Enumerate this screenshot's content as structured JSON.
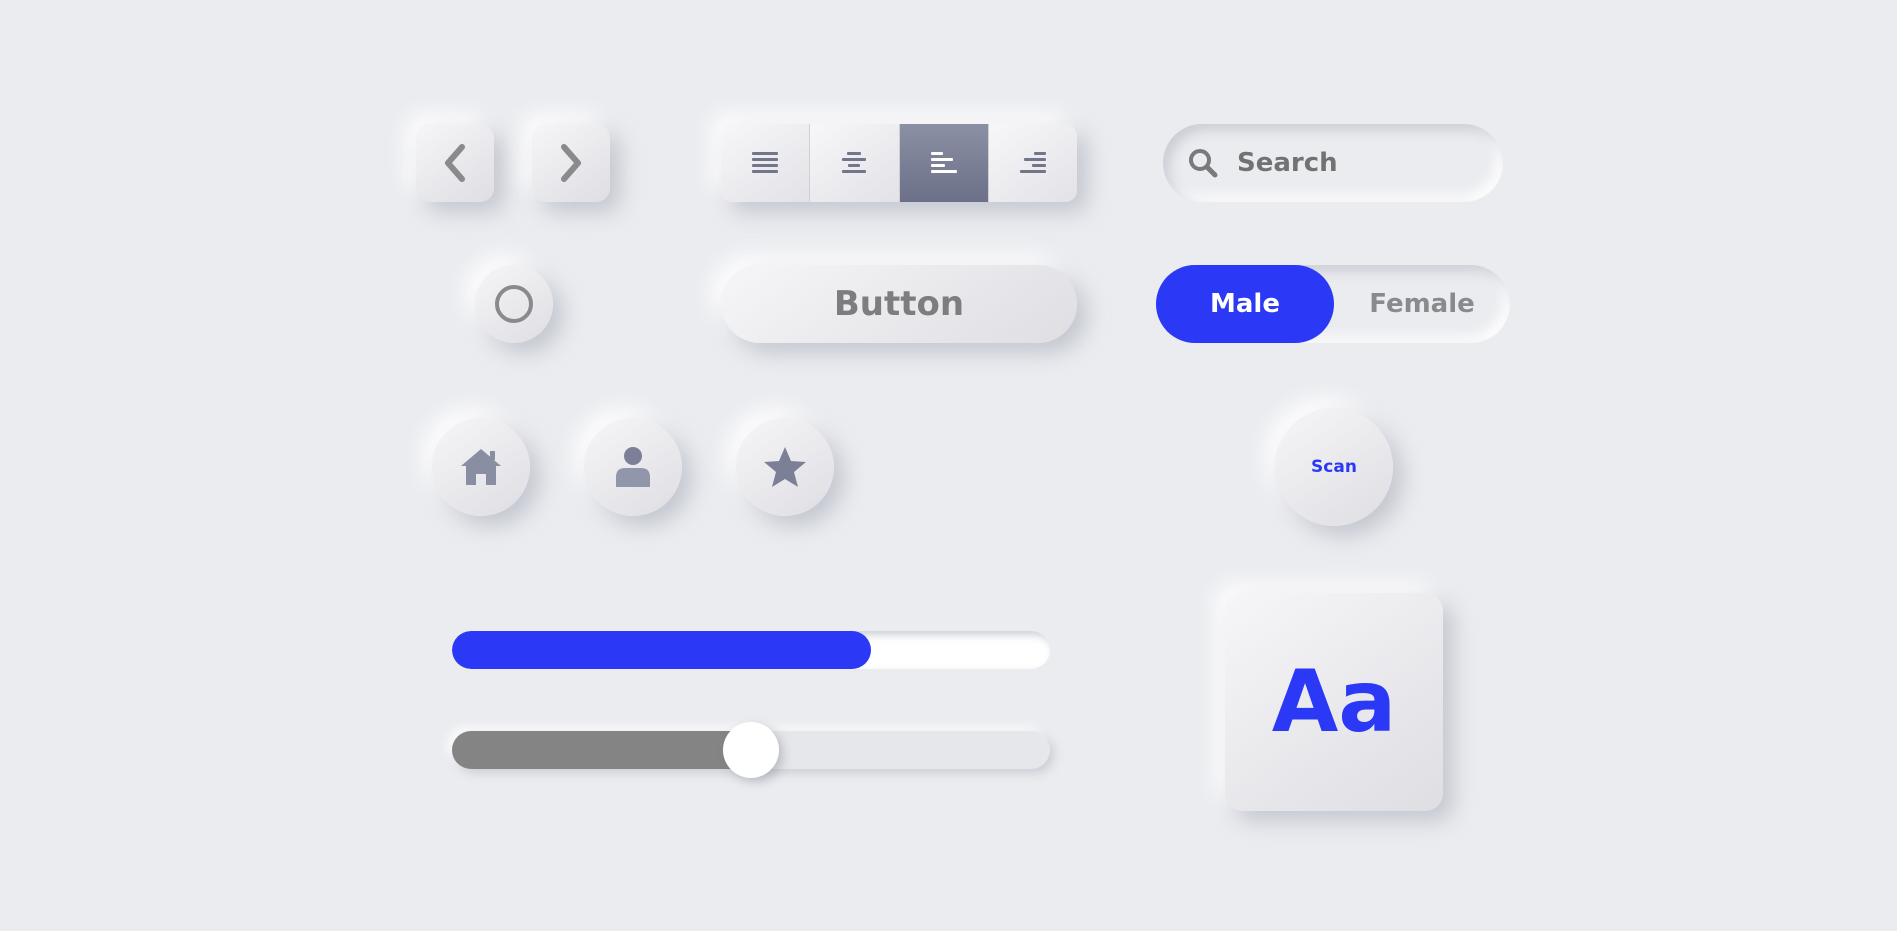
{
  "nav": {
    "prev_icon": "chevron-left-icon",
    "next_icon": "chevron-right-icon"
  },
  "align": {
    "options": [
      "align-justify-icon",
      "align-center-icon",
      "align-left-icon",
      "align-right-icon"
    ],
    "selected": "align-left"
  },
  "search": {
    "placeholder": "Search",
    "icon": "search-icon"
  },
  "radio": {
    "checked": false
  },
  "button": {
    "label": "Button"
  },
  "gender": {
    "male": "Male",
    "female": "Female",
    "selected": "Male"
  },
  "icon_buttons": [
    "home-icon",
    "user-icon",
    "star-icon"
  ],
  "scan": {
    "label": "Scan"
  },
  "progress": {
    "value": 0.7
  },
  "slider": {
    "value": 0.5
  },
  "font_card": {
    "label": "Aa"
  },
  "colors": {
    "background": "#ebecf0",
    "accent": "#2b39f7",
    "icon": "#8a8ea3",
    "text_muted": "#7d7d80",
    "slider_fill": "#848484"
  }
}
